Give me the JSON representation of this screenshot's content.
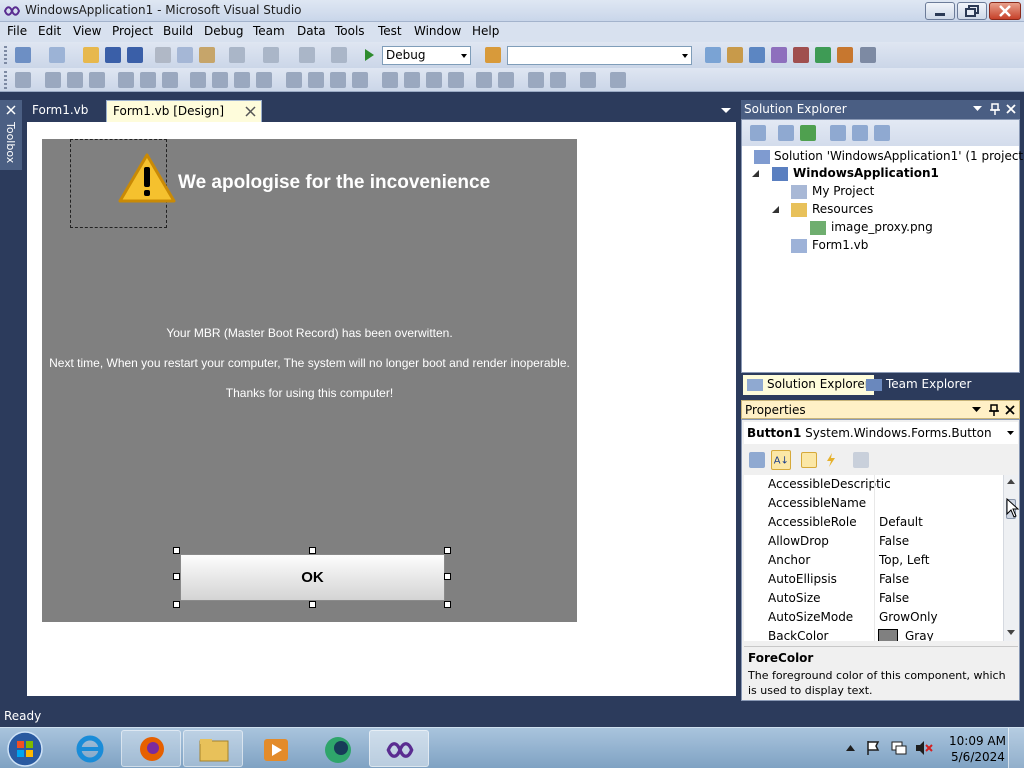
{
  "window": {
    "title": "WindowsApplication1 - Microsoft Visual Studio"
  },
  "menu": [
    "File",
    "Edit",
    "View",
    "Project",
    "Build",
    "Debug",
    "Team",
    "Data",
    "Tools",
    "Test",
    "Window",
    "Help"
  ],
  "toolbar": {
    "config": "Debug",
    "platform": ""
  },
  "toolbox": {
    "label": "Toolbox"
  },
  "tabs": [
    {
      "label": "Form1.vb"
    },
    {
      "label": "Form1.vb [Design]"
    }
  ],
  "form": {
    "headline": "We apologise for the incovenience",
    "lines": [
      "Your MBR (Master Boot Record) has been overwitten.",
      "Next time, When you restart your computer, The system will no longer boot and render inoperable.",
      "Thanks for using this computer!"
    ],
    "ok": "OK",
    "bg": "#808080"
  },
  "solution_explorer": {
    "title": "Solution Explorer",
    "items": [
      "Solution 'WindowsApplication1' (1 project)",
      "WindowsApplication1",
      "My Project",
      "Resources",
      "image_proxy.png",
      "Form1.vb"
    ],
    "tabs": [
      "Solution Explorer",
      "Team Explorer"
    ]
  },
  "properties": {
    "title": "Properties",
    "object": "Button1",
    "object_type": "System.Windows.Forms.Button",
    "rows": [
      {
        "name": "AccessibleDescriptic",
        "value": ""
      },
      {
        "name": "AccessibleName",
        "value": ""
      },
      {
        "name": "AccessibleRole",
        "value": "Default"
      },
      {
        "name": "AllowDrop",
        "value": "False"
      },
      {
        "name": "Anchor",
        "value": "Top, Left"
      },
      {
        "name": "AutoEllipsis",
        "value": "False"
      },
      {
        "name": "AutoSize",
        "value": "False"
      },
      {
        "name": "AutoSizeMode",
        "value": "GrowOnly"
      },
      {
        "name": "BackColor",
        "value": "Gray"
      }
    ],
    "desc_title": "ForeColor",
    "desc_text": "The foreground color of this component, which is used to display text."
  },
  "status": "Ready",
  "clock": {
    "time": "10:09 AM",
    "date": "5/6/2024"
  }
}
